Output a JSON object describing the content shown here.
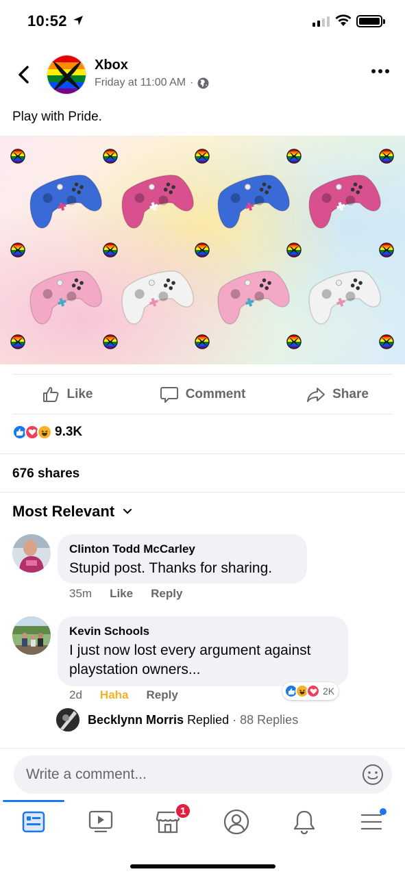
{
  "status_bar": {
    "time": "10:52"
  },
  "post": {
    "page_name": "Xbox",
    "timestamp": "Friday at 11:00 AM",
    "meta_separator": "·",
    "text": "Play with Pride.",
    "image_description_icon": "controllers-grid-image"
  },
  "actions": {
    "like": "Like",
    "comment": "Comment",
    "share": "Share"
  },
  "reactions": {
    "count": "9.3K",
    "types": [
      "like",
      "love",
      "haha"
    ]
  },
  "shares": "676 shares",
  "sort": {
    "label": "Most Relevant"
  },
  "comments": [
    {
      "author": "Clinton Todd McCarley",
      "text": "Stupid post. Thanks for sharing.",
      "time": "35m",
      "like_label": "Like",
      "reply_label": "Reply"
    },
    {
      "author": "Kevin Schools",
      "text": "I just now lost every argument against playstation owners...",
      "time": "2d",
      "reaction_label": "Haha",
      "reply_label": "Reply",
      "reaction_count": "2K",
      "reply_preview": {
        "author": "Becklynn Morris",
        "action": "Replied",
        "separator": "·",
        "count": "88 Replies"
      }
    }
  ],
  "composer": {
    "placeholder": "Write a comment..."
  },
  "tabs": {
    "items": [
      "news-feed",
      "watch",
      "marketplace",
      "profile",
      "notifications",
      "menu"
    ],
    "marketplace_badge": "1"
  },
  "colors": {
    "accent": "#1877f2",
    "haha": "#f7b125",
    "love": "#f33e58",
    "badge": "#e41e3f",
    "muted": "#65676b"
  }
}
